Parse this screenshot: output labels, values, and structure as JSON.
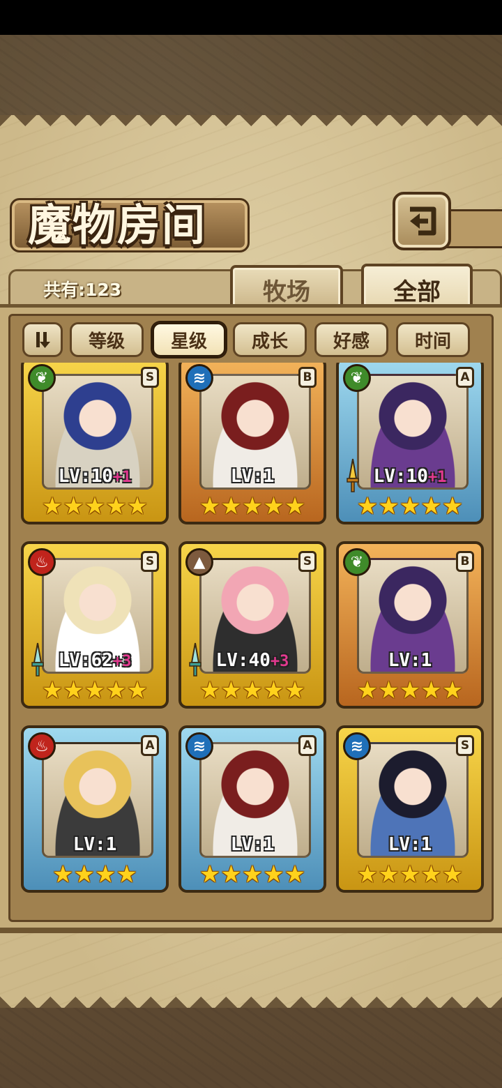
{
  "header": {
    "title": "魔物房间",
    "count_label": "共有:123"
  },
  "tabs": [
    {
      "label": "牧场",
      "active": false
    },
    {
      "label": "全部",
      "active": true
    }
  ],
  "sort": {
    "buttons": [
      {
        "label": "等级",
        "active": false
      },
      {
        "label": "星级",
        "active": true
      },
      {
        "label": "成长",
        "active": false
      },
      {
        "label": "好感",
        "active": false
      },
      {
        "label": "时间",
        "active": false
      }
    ]
  },
  "cards": [
    {
      "element": "leaf-icon",
      "rank": "S",
      "frame": "gold",
      "level": "LV:10",
      "bonus": "+1",
      "stars": "★★★★★",
      "weapon": false
    },
    {
      "element": "water-icon",
      "rank": "B",
      "frame": "orange",
      "level": "LV:1",
      "bonus": "",
      "stars": "★★★★★",
      "weapon": false
    },
    {
      "element": "leaf-icon",
      "rank": "A",
      "frame": "blue",
      "level": "LV:10",
      "bonus": "+1",
      "stars": "★★★★★",
      "weapon": true
    },
    {
      "element": "fire-icon",
      "rank": "S",
      "frame": "gold",
      "level": "LV:62",
      "bonus": "+3",
      "stars": "★★★★★",
      "weapon": true
    },
    {
      "element": "earth-icon",
      "rank": "S",
      "frame": "gold",
      "level": "LV:40",
      "bonus": "+3",
      "stars": "★★★★★",
      "weapon": true
    },
    {
      "element": "leaf-icon",
      "rank": "B",
      "frame": "orange",
      "level": "LV:1",
      "bonus": "",
      "stars": "★★★★★",
      "weapon": false
    },
    {
      "element": "fire-icon",
      "rank": "A",
      "frame": "blue",
      "level": "LV:1",
      "bonus": "",
      "stars": "★★★★",
      "weapon": false
    },
    {
      "element": "water-icon",
      "rank": "A",
      "frame": "blue",
      "level": "LV:1",
      "bonus": "",
      "stars": "★★★★★",
      "weapon": false
    },
    {
      "element": "water-icon",
      "rank": "S",
      "frame": "gold",
      "level": "LV:1",
      "bonus": "",
      "stars": "★★★★★",
      "weapon": false
    }
  ],
  "colors": {
    "frame_gold": "#f7d54a",
    "frame_orange": "#f3b35a",
    "frame_blue": "#9fd9ef",
    "bonus": "#e2398f",
    "star": "#ffd21c"
  }
}
